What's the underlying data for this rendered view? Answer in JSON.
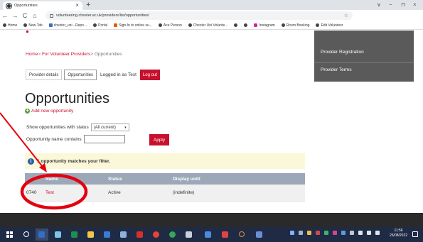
{
  "browser": {
    "tab_title": "Opportunities",
    "tab_close": "×",
    "new_tab": "+",
    "url": "volunteering.chester.ac.uk/providers/list/opportunities/",
    "window_controls": [
      "∨",
      "−",
      "⊓",
      "×"
    ],
    "nav": [
      "←",
      "→",
      "C",
      "⌂"
    ],
    "bookmarks": [
      {
        "label": "Home",
        "icon": "globe-icon"
      },
      {
        "label": "New Tab",
        "icon": "globe-icon"
      },
      {
        "label": "chester_uni - Repo...",
        "icon": "doc-icon"
      },
      {
        "label": "Portal",
        "icon": "globe-icon"
      },
      {
        "label": "Sign In to online su...",
        "icon": "orange-icon"
      },
      {
        "label": "Ace Person",
        "icon": "globe-icon"
      },
      {
        "label": "Chester Uni Volunte...",
        "icon": "globe-icon"
      },
      {
        "label": "",
        "icon": "globe-icon"
      },
      {
        "label": "",
        "icon": "globe-icon"
      },
      {
        "label": "Instagram",
        "icon": "instagram-icon"
      },
      {
        "label": "Room Booking",
        "icon": "globe-icon"
      },
      {
        "label": "Edit Volunteer",
        "icon": "globe-icon"
      }
    ]
  },
  "side_menu": {
    "items": [
      "Provider Registration",
      "Provider Terms"
    ]
  },
  "breadcrumb": {
    "home": "Home",
    "sep": ">",
    "providers": "For Volunteer Providers",
    "current": "Opportunities"
  },
  "account": {
    "provider_details": "Provider details",
    "opportunities": "Opportunities",
    "logged_in": "Logged in as Test",
    "logout": "Log out"
  },
  "page": {
    "title": "Opportunities",
    "add_new": "Add new opportunity"
  },
  "filters": {
    "status_label": "Show opportunities with status",
    "status_value": "(All current)",
    "name_label": "Opportunity name contains",
    "name_value": "",
    "apply": "Apply"
  },
  "alert": {
    "text": "1 opportunity matches your filter."
  },
  "table": {
    "columns": [
      "Name",
      "Status",
      "Display until"
    ],
    "rows": [
      {
        "id": "0740",
        "name": "Test",
        "status": "Active",
        "display_until": "(indefinite)"
      }
    ]
  },
  "taskbar": {
    "time": "11:56",
    "date": "26/08/2022"
  },
  "colors": {
    "brand_red": "#c8102e",
    "table_header": "#9ca8b8",
    "alert_bg": "#fbf7d9",
    "annotation": "#e3000f"
  }
}
